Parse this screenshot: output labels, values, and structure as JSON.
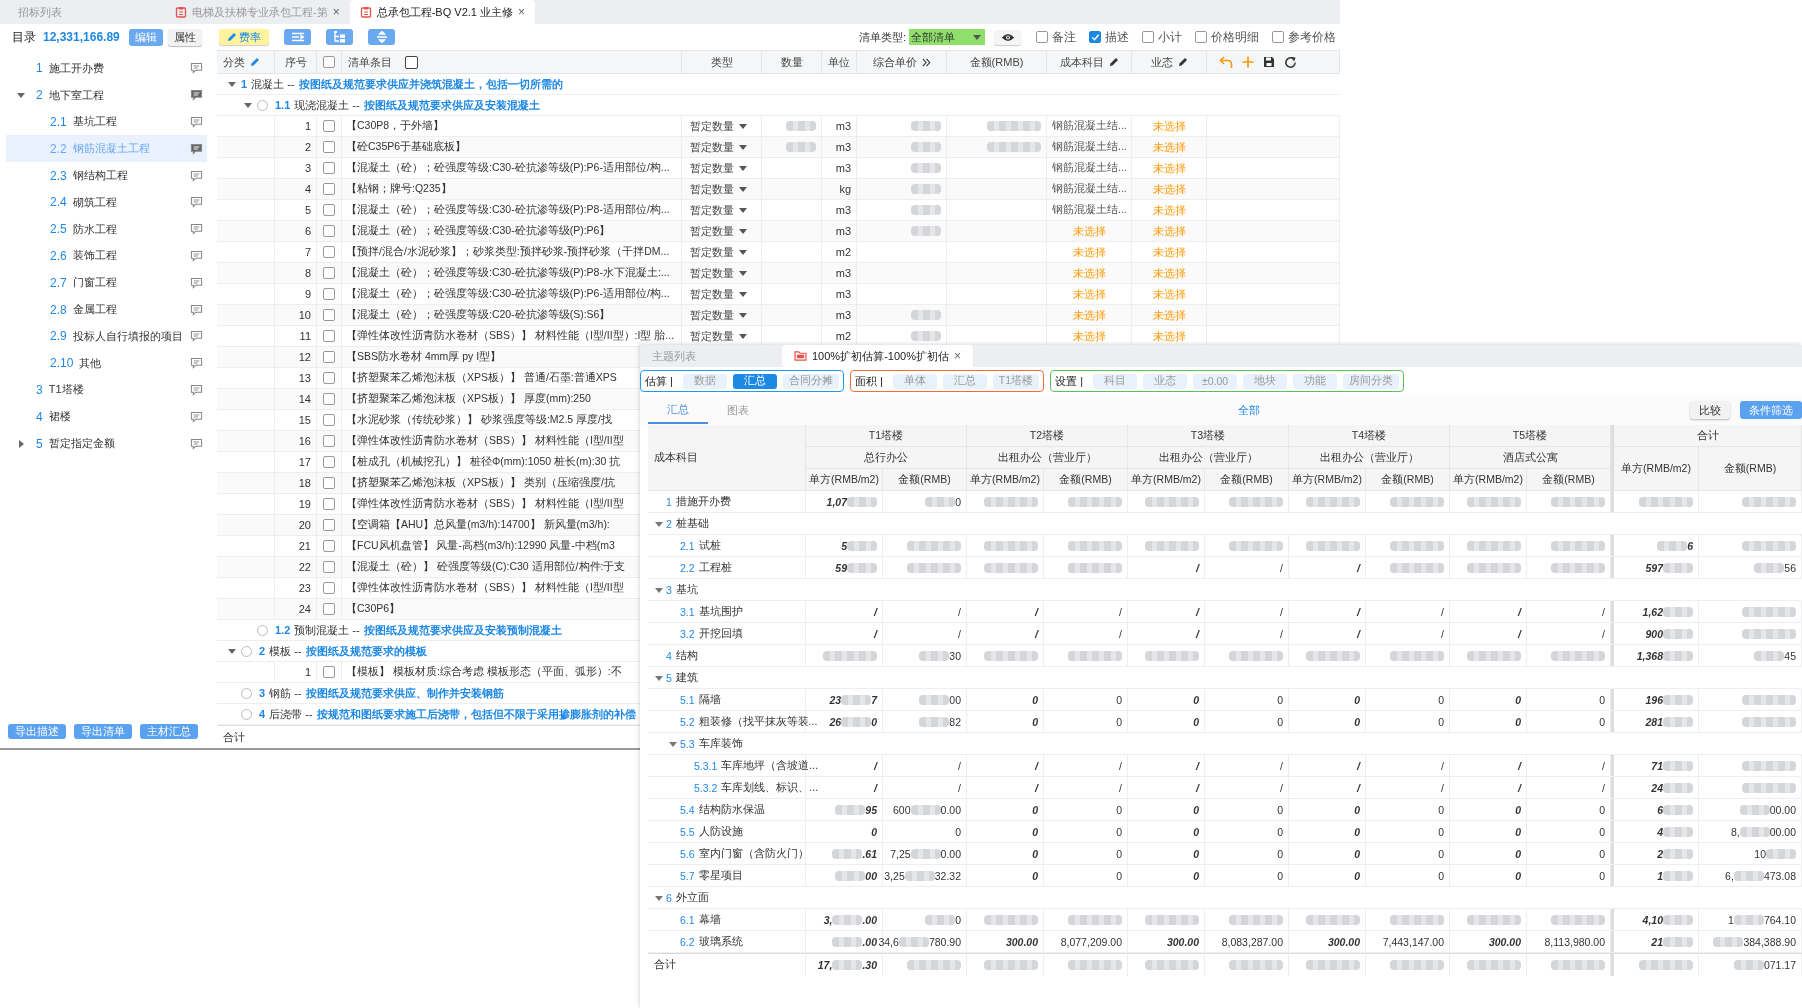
{
  "top_window": {
    "tabs": [
      {
        "label": "招标列表",
        "selected": false
      },
      {
        "label": "电梯及扶梯专业承包工程-第",
        "selected": false,
        "close": "×"
      },
      {
        "label": "总承包工程-BQ V2.1 业主修",
        "selected": true,
        "close": "×"
      }
    ],
    "sidebar": {
      "title": "目录",
      "total": "12,331,166.89",
      "buttons": [
        {
          "label": "编辑",
          "kind": "primary"
        },
        {
          "label": "属性",
          "kind": "plain"
        }
      ],
      "items": [
        {
          "number": "1",
          "label": "施工开办费",
          "selected": false,
          "commented": false
        },
        {
          "number": "2",
          "label": "地下室工程",
          "selected": false,
          "commented": true,
          "expanded": true,
          "children": [
            {
              "number": "2.1",
              "label": "基坑工程",
              "selected": false,
              "commented": false
            },
            {
              "number": "2.2",
              "label": "钢筋混凝土工程",
              "selected": true,
              "commented": true
            },
            {
              "number": "2.3",
              "label": "钢结构工程",
              "selected": false,
              "commented": false
            },
            {
              "number": "2.4",
              "label": "砌筑工程",
              "selected": false,
              "commented": false
            },
            {
              "number": "2.5",
              "label": "防水工程",
              "selected": false,
              "commented": false
            },
            {
              "number": "2.6",
              "label": "装饰工程",
              "selected": false,
              "commented": false
            },
            {
              "number": "2.7",
              "label": "门窗工程",
              "selected": false,
              "commented": false
            },
            {
              "number": "2.8",
              "label": "金属工程",
              "selected": false,
              "commented": false
            },
            {
              "number": "2.9",
              "label": "投标人自行填报的项目",
              "selected": false,
              "commented": false
            },
            {
              "number": "2.10",
              "label": "其他",
              "selected": false,
              "commented": false
            }
          ]
        },
        {
          "number": "3",
          "label": "T1塔楼",
          "selected": false,
          "commented": false
        },
        {
          "number": "4",
          "label": "裙楼",
          "selected": false,
          "commented": false
        },
        {
          "number": "5",
          "label": "暂定指定金额",
          "selected": false,
          "commented": false,
          "expanded": false
        }
      ],
      "footer_buttons": [
        "导出描述",
        "导出清单",
        "主材汇总"
      ]
    },
    "rate_button": "费率",
    "list_type": {
      "label": "清单类型:",
      "value": "全部清单"
    },
    "options": [
      {
        "label": "备注",
        "checked": false
      },
      {
        "label": "描述",
        "checked": true
      },
      {
        "label": "小计",
        "checked": false
      },
      {
        "label": "价格明细",
        "checked": false
      },
      {
        "label": "参考价格",
        "checked": false
      }
    ],
    "table": {
      "columns": [
        {
          "label": "分类",
          "editable": true
        },
        {
          "label": "序号"
        },
        {
          "label": "清单条目"
        },
        {
          "label": "类型"
        },
        {
          "label": "数量"
        },
        {
          "label": "单位"
        },
        {
          "label": "综合单价",
          "expandable": true
        },
        {
          "label": "金额(RMB)"
        },
        {
          "label": "成本科目",
          "editable": true
        },
        {
          "label": "业态",
          "editable": true
        }
      ],
      "select_all": {
        "checked": false
      },
      "entry_toggle": {
        "checked": false
      },
      "rows": [
        {
          "kind": "group",
          "number": "1",
          "name": "混凝土 --",
          "desc": "按图纸及规范要求供应并浇筑混凝土，包括一切所需的",
          "expanded": true,
          "children": [
            {
              "kind": "group",
              "number": "1.1",
              "name": "现浇混凝土 --",
              "desc": "按图纸及规范要求供应及安装混凝土",
              "selected": false,
              "expanded": true,
              "children": [
                {
                  "kind": "item",
                  "no": "1",
                  "checked": false,
                  "desc": "【C30P8，于外墙】",
                  "type": "暂定数量",
                  "qty_blurred": true,
                  "unit": "m3",
                  "price_blurred": true,
                  "amount_blurred": true,
                  "cost": {
                    "text": "钢筋混凝土结...",
                    "assigned": true
                  },
                  "status": {
                    "text": "未选择",
                    "assigned": false
                  }
                },
                {
                  "kind": "item",
                  "no": "2",
                  "checked": false,
                  "desc": "【砼C35P6于基础底板】",
                  "type": "暂定数量",
                  "qty_blurred": true,
                  "unit": "m3",
                  "price_blurred": true,
                  "amount_blurred": true,
                  "cost": {
                    "text": "钢筋混凝土结...",
                    "assigned": true
                  },
                  "status": {
                    "text": "未选择",
                    "assigned": false
                  }
                },
                {
                  "kind": "item",
                  "no": "3",
                  "checked": false,
                  "desc": "【混凝土（砼）；砼强度等级:C30-砼抗渗等级(P):P6-适用部位/构...",
                  "type": "暂定数量",
                  "qty_blurred": false,
                  "unit": "m3",
                  "price_blurred": true,
                  "amount_blurred": false,
                  "cost": {
                    "text": "钢筋混凝土结...",
                    "assigned": true
                  },
                  "status": {
                    "text": "未选择",
                    "assigned": false
                  }
                },
                {
                  "kind": "item",
                  "no": "4",
                  "checked": false,
                  "desc": "【粘钢；牌号:Q235】",
                  "type": "暂定数量",
                  "qty_blurred": false,
                  "unit": "kg",
                  "price_blurred": true,
                  "amount_blurred": false,
                  "cost": {
                    "text": "钢筋混凝土结...",
                    "assigned": true
                  },
                  "status": {
                    "text": "未选择",
                    "assigned": false
                  }
                },
                {
                  "kind": "item",
                  "no": "5",
                  "checked": false,
                  "desc": "【混凝土（砼）；砼强度等级:C30-砼抗渗等级(P):P8-适用部位/构...",
                  "type": "暂定数量",
                  "qty_blurred": false,
                  "unit": "m3",
                  "price_blurred": true,
                  "amount_blurred": false,
                  "cost": {
                    "text": "钢筋混凝土结...",
                    "assigned": true
                  },
                  "status": {
                    "text": "未选择",
                    "assigned": false
                  }
                },
                {
                  "kind": "item",
                  "no": "6",
                  "checked": false,
                  "desc": "【混凝土（砼）；砼强度等级:C30-砼抗渗等级(P):P6】",
                  "type": "暂定数量",
                  "qty_blurred": false,
                  "unit": "m3",
                  "price_blurred": true,
                  "amount_blurred": false,
                  "cost": {
                    "text": "未选择",
                    "assigned": false
                  },
                  "status": {
                    "text": "未选择",
                    "assigned": false
                  }
                },
                {
                  "kind": "item",
                  "no": "7",
                  "checked": false,
                  "desc": "【预拌/混合/水泥砂浆】；砂浆类型:预拌砂浆-预拌砂浆（干拌DM...",
                  "type": "暂定数量",
                  "qty_blurred": false,
                  "unit": "m2",
                  "price_blurred": false,
                  "amount_blurred": false,
                  "cost": {
                    "text": "未选择",
                    "assigned": false
                  },
                  "status": {
                    "text": "未选择",
                    "assigned": false
                  }
                },
                {
                  "kind": "item",
                  "no": "8",
                  "checked": false,
                  "desc": "【混凝土（砼）；砼强度等级:C30-砼抗渗等级(P):P8-水下混凝土:...",
                  "type": "暂定数量",
                  "qty_blurred": false,
                  "unit": "m3",
                  "price_blurred": false,
                  "amount_blurred": false,
                  "cost": {
                    "text": "未选择",
                    "assigned": false
                  },
                  "status": {
                    "text": "未选择",
                    "assigned": false
                  }
                },
                {
                  "kind": "item",
                  "no": "9",
                  "checked": false,
                  "desc": "【混凝土（砼）；砼强度等级:C30-砼抗渗等级(P):P6-适用部位/构...",
                  "type": "暂定数量",
                  "qty_blurred": false,
                  "unit": "m3",
                  "price_blurred": false,
                  "amount_blurred": false,
                  "cost": {
                    "text": "未选择",
                    "assigned": false
                  },
                  "status": {
                    "text": "未选择",
                    "assigned": false
                  }
                },
                {
                  "kind": "item",
                  "no": "10",
                  "checked": false,
                  "desc": "【混凝土（砼）；砼强度等级:C20-砼抗渗等级(S):S6】",
                  "type": "暂定数量",
                  "qty_blurred": false,
                  "unit": "m3",
                  "price_blurred": true,
                  "amount_blurred": false,
                  "cost": {
                    "text": "未选择",
                    "assigned": false
                  },
                  "status": {
                    "text": "未选择",
                    "assigned": false
                  }
                },
                {
                  "kind": "item",
                  "no": "11",
                  "checked": false,
                  "desc": "【弹性体改性沥青防水卷材（SBS）】 材料性能（I型/II型）:I型 胎...",
                  "type": "暂定数量",
                  "qty_blurred": false,
                  "unit": "m2",
                  "price_blurred": true,
                  "amount_blurred": false,
                  "cost": {
                    "text": "未选择",
                    "assigned": false
                  },
                  "status": {
                    "text": "未选择",
                    "assigned": false
                  }
                },
                {
                  "kind": "item",
                  "no": "12",
                  "checked": false,
                  "desc": "【SBS防水卷材 4mm厚 py I型】"
                },
                {
                  "kind": "item",
                  "no": "13",
                  "checked": false,
                  "desc": "【挤塑聚苯乙烯泡沫板（XPS板）】 普通/石墨:普通XPS"
                },
                {
                  "kind": "item",
                  "no": "14",
                  "checked": false,
                  "desc": "【挤塑聚苯乙烯泡沫板（XPS板）】 厚度(mm):250"
                },
                {
                  "kind": "item",
                  "no": "15",
                  "checked": false,
                  "desc": "【水泥砂浆（传统砂浆）】 砂浆强度等级:M2.5 厚度/找"
                },
                {
                  "kind": "item",
                  "no": "16",
                  "checked": false,
                  "desc": "【弹性体改性沥青防水卷材（SBS）】 材料性能（I型/II型"
                },
                {
                  "kind": "item",
                  "no": "17",
                  "checked": false,
                  "desc": "【桩成孔（机械挖孔）】 桩径Φ(mm):1050 桩长(m):30 抗"
                },
                {
                  "kind": "item",
                  "no": "18",
                  "checked": false,
                  "desc": "【挤塑聚苯乙烯泡沫板（XPS板）】 类别（压缩强度/抗"
                },
                {
                  "kind": "item",
                  "no": "19",
                  "checked": false,
                  "desc": "【弹性体改性沥青防水卷材（SBS）】 材料性能（I型/II型"
                },
                {
                  "kind": "item",
                  "no": "20",
                  "checked": false,
                  "desc": "【空调箱【AHU】总风量(m3/h):14700】 新风量(m3/h):"
                },
                {
                  "kind": "item",
                  "no": "21",
                  "checked": false,
                  "desc": "【FCU风机盘管】 风量-高档(m3/h):12990 风量-中档(m3"
                },
                {
                  "kind": "item",
                  "no": "22",
                  "checked": false,
                  "desc": "【混凝土（砼）】 砼强度等级(C):C30 适用部位/构件:于支"
                },
                {
                  "kind": "item",
                  "no": "23",
                  "checked": false,
                  "desc": "【弹性体改性沥青防水卷材（SBS）】 材料性能（I型/II型"
                },
                {
                  "kind": "item",
                  "no": "24",
                  "checked": false,
                  "desc": "【C30P6】"
                }
              ]
            },
            {
              "kind": "group",
              "number": "1.2",
              "name": "预制混凝土 --",
              "desc": "按图纸及规范要求供应及安装预制混凝土",
              "selected": false
            }
          ]
        },
        {
          "kind": "group",
          "number": "2",
          "name": "模板 --",
          "desc": "按图纸及规范要求的模板",
          "selected": false,
          "expanded": true,
          "children": [
            {
              "kind": "item",
              "no": "1",
              "checked": false,
              "desc": "【模板】 模板材质:综合考虑 模板形态（平面、弧形）:不"
            }
          ]
        },
        {
          "kind": "group",
          "number": "3",
          "name": "钢筋 --",
          "desc": "按图纸及规范要求供应、制作并安装钢筋",
          "selected": false
        },
        {
          "kind": "group",
          "number": "4",
          "name": "后浇带 --",
          "desc": "按规范和图纸要求施工后浇带，包括但不限于采用掺膨胀剂的补偿",
          "selected": false
        }
      ],
      "footer": "合计"
    }
  },
  "bottom_panel": {
    "tabs": [
      {
        "label": "主题列表",
        "selected": false
      },
      {
        "label": "100%扩初估算-100%扩初估",
        "selected": true,
        "close": "×"
      }
    ],
    "filter_groups": [
      {
        "label": "估算 |",
        "color": "#1e9bf0",
        "options": [
          {
            "label": "数据",
            "selected": false
          },
          {
            "label": "汇总",
            "selected": true
          },
          {
            "label": "合同分摊",
            "selected": false
          }
        ]
      },
      {
        "label": "面积 |",
        "color": "#f26b3a",
        "options": [
          {
            "label": "单体",
            "selected": false
          },
          {
            "label": "汇总",
            "selected": false
          },
          {
            "label": "T1塔楼",
            "selected": false
          }
        ]
      },
      {
        "label": "设置 |",
        "color": "#5cbf5c",
        "options": [
          {
            "label": "科目",
            "selected": false
          },
          {
            "label": "业态",
            "selected": false
          },
          {
            "label": "±0.00",
            "selected": false
          },
          {
            "label": "地块",
            "selected": false
          },
          {
            "label": "功能",
            "selected": false
          },
          {
            "label": "房间分类",
            "selected": false
          }
        ]
      }
    ],
    "view_tabs": [
      {
        "label": "汇总",
        "selected": true
      },
      {
        "label": "图表",
        "selected": false
      }
    ],
    "scope": "全部",
    "buttons": [
      {
        "label": "比较",
        "kind": "plain"
      },
      {
        "label": "条件筛选",
        "kind": "primary"
      }
    ],
    "table": {
      "first_column": "成本科目",
      "groups": [
        {
          "name": "T1塔楼",
          "use": "总行办公",
          "columns": [
            "单方(RMB/m2)",
            "金额(RMB)"
          ]
        },
        {
          "name": "T2塔楼",
          "use": "出租办公（营业厅）",
          "columns": [
            "单方(RMB/m2)",
            "金额(RMB)"
          ]
        },
        {
          "name": "T3塔楼",
          "use": "出租办公（营业厅）",
          "columns": [
            "单方(RMB/m2)",
            "金额(RMB)"
          ]
        },
        {
          "name": "T4塔楼",
          "use": "出租办公（营业厅）",
          "columns": [
            "单方(RMB/m2)",
            "金额(RMB)"
          ]
        },
        {
          "name": "T5塔楼",
          "use": "酒店式公寓",
          "columns": [
            "单方(RMB/m2)",
            "金额(RMB)"
          ]
        }
      ],
      "total": {
        "name": "合计",
        "columns": [
          "单方(RMB/m2)",
          "金额(RMB)"
        ]
      },
      "rows": [
        {
          "number": "1",
          "name": "措施开办费",
          "cells": [
            {
              "head": "1,07",
              "blurred": true
            },
            {
              "tail": "0",
              "blurred": true
            },
            {
              "blurred": true
            },
            {
              "blurred": true
            },
            {
              "blurred": true
            },
            {
              "blurred": true
            },
            {
              "blurred": true
            },
            {
              "blurred": true
            },
            {
              "blurred": true
            },
            {
              "blurred": true
            },
            {
              "blurred": true
            },
            {
              "blurred": true
            }
          ]
        },
        {
          "number": "2",
          "name": "桩基础",
          "expanded": true,
          "children": [
            {
              "number": "2.1",
              "name": "试桩",
              "cells": [
                {
                  "head": "5",
                  "blurred": true
                },
                {
                  "blurred": true
                },
                {
                  "blurred": true
                },
                {
                  "blurred": true
                },
                {
                  "blurred": true
                },
                {
                  "blurred": true
                },
                {
                  "blurred": true
                },
                {
                  "blurred": true
                },
                {
                  "blurred": true
                },
                {
                  "blurred": true
                },
                {
                  "tail": "6",
                  "blurred": true
                },
                {
                  "blurred": true
                }
              ]
            },
            {
              "number": "2.2",
              "name": "工程桩",
              "cells": [
                {
                  "head": "59",
                  "blurred": true
                },
                {
                  "blurred": true
                },
                {
                  "blurred": true
                },
                {
                  "blurred": true
                },
                "/",
                "/",
                "/",
                {
                  "blurred": true
                },
                {
                  "blurred": true
                },
                {
                  "blurred": true
                },
                {
                  "head": "597",
                  "blurred": true
                },
                {
                  "tail": "56",
                  "blurred": true
                }
              ]
            }
          ]
        },
        {
          "number": "3",
          "name": "基坑",
          "expanded": true,
          "children": [
            {
              "number": "3.1",
              "name": "基坑围护",
              "cells": [
                "/",
                "/",
                "/",
                "/",
                "/",
                "/",
                "/",
                "/",
                "/",
                "/",
                {
                  "head": "1,62",
                  "blurred": true
                },
                {
                  "blurred": true
                }
              ]
            },
            {
              "number": "3.2",
              "name": "开挖回填",
              "cells": [
                "/",
                "/",
                "/",
                "/",
                "/",
                "/",
                "/",
                "/",
                "/",
                "/",
                {
                  "head": "900",
                  "blurred": true
                },
                {
                  "blurred": true
                }
              ]
            }
          ]
        },
        {
          "number": "4",
          "name": "结构",
          "cells": [
            {
              "blurred": true
            },
            {
              "tail": "30",
              "blurred": true
            },
            {
              "blurred": true
            },
            {
              "blurred": true
            },
            {
              "blurred": true
            },
            {
              "blurred": true
            },
            {
              "blurred": true
            },
            {
              "blurred": true
            },
            {
              "blurred": true
            },
            {
              "blurred": true
            },
            {
              "head": "1,368",
              "blurred": true
            },
            {
              "tail": "45",
              "blurred": true
            }
          ]
        },
        {
          "number": "5",
          "name": "建筑",
          "expanded": true,
          "children": [
            {
              "number": "5.1",
              "name": "隔墙",
              "cells": [
                {
                  "head": "23",
                  "tail": "7",
                  "blurred": true
                },
                {
                  "tail": "00",
                  "blurred": true
                },
                "0",
                "0",
                "0",
                "0",
                "0",
                "0",
                "0",
                "0",
                {
                  "head": "196",
                  "blurred": true
                },
                {
                  "blurred": true
                }
              ]
            },
            {
              "number": "5.2",
              "name": "粗装修（找平抹灰等装...",
              "cells": [
                {
                  "head": "26",
                  "tail": "0",
                  "blurred": true
                },
                {
                  "tail": "82",
                  "blurred": true
                },
                "0",
                "0",
                "0",
                "0",
                "0",
                "0",
                "0",
                "0",
                {
                  "head": "281",
                  "blurred": true
                },
                {
                  "blurred": true
                }
              ]
            },
            {
              "number": "5.3",
              "name": "车库装饰",
              "expanded": true,
              "children": [
                {
                  "number": "5.3.1",
                  "name": "车库地坪（含坡道...",
                  "cells": [
                    "/",
                    "/",
                    "/",
                    "/",
                    "/",
                    "/",
                    "/",
                    "/",
                    "/",
                    "/",
                    {
                      "head": "71",
                      "blurred": true
                    },
                    {
                      "blurred": true
                    }
                  ]
                },
                {
                  "number": "5.3.2",
                  "name": "车库划线、标识、...",
                  "cells": [
                    "/",
                    "/",
                    "/",
                    "/",
                    "/",
                    "/",
                    "/",
                    "/",
                    "/",
                    "/",
                    {
                      "head": "24",
                      "blurred": true
                    },
                    {
                      "blurred": true
                    }
                  ]
                }
              ]
            },
            {
              "number": "5.4",
              "name": "结构防水保温",
              "cells": [
                {
                  "tail": "95",
                  "blurred": true
                },
                {
                  "head": "600",
                  "tail": "0.00",
                  "blurred": true
                },
                "0",
                "0",
                "0",
                "0",
                "0",
                "0",
                "0",
                "0",
                {
                  "head": "6",
                  "blurred": true
                },
                {
                  "tail": "00.00",
                  "blurred": true
                }
              ]
            },
            {
              "number": "5.5",
              "name": "人防设施",
              "cells": [
                "0",
                "0",
                "0",
                "0",
                "0",
                "0",
                "0",
                "0",
                "0",
                "0",
                {
                  "head": "4",
                  "blurred": true
                },
                {
                  "head": "8,",
                  "tail": "00.00",
                  "blurred": true
                }
              ]
            },
            {
              "number": "5.6",
              "name": "室内门窗（含防火门）",
              "cells": [
                {
                  "tail": ".61",
                  "blurred": true
                },
                {
                  "head": "7,25",
                  "tail": "0.00",
                  "blurred": true
                },
                "0",
                "0",
                "0",
                "0",
                "0",
                "0",
                "0",
                "0",
                {
                  "head": "2",
                  "blurred": true
                },
                {
                  "head": "10",
                  "blurred": true
                }
              ]
            },
            {
              "number": "5.7",
              "name": "零星项目",
              "cells": [
                {
                  "tail": "00",
                  "blurred": true
                },
                {
                  "head": "3,25",
                  "tail": "32.32",
                  "blurred": true
                },
                "0",
                "0",
                "0",
                "0",
                "0",
                "0",
                "0",
                "0",
                {
                  "head": "1",
                  "blurred": true
                },
                {
                  "head": "6,",
                  "tail": "473.08",
                  "blurred": true
                }
              ]
            }
          ]
        },
        {
          "number": "6",
          "name": "外立面",
          "expanded": true,
          "children": [
            {
              "number": "6.1",
              "name": "幕墙",
              "cells": [
                {
                  "head": "3,",
                  "tail": ".00",
                  "blurred": true
                },
                {
                  "tail": "0",
                  "blurred": true
                },
                {
                  "blurred": true
                },
                {
                  "blurred": true
                },
                {
                  "blurred": true
                },
                {
                  "blurred": true
                },
                {
                  "blurred": true
                },
                {
                  "blurred": true
                },
                {
                  "blurred": true
                },
                {
                  "blurred": true
                },
                {
                  "head": "4,10",
                  "blurred": true
                },
                {
                  "head": "1",
                  "tail": "764.10",
                  "blurred": true
                }
              ]
            },
            {
              "number": "6.2",
              "name": "玻璃系统",
              "cells": [
                {
                  "tail": ".00",
                  "blurred": true
                },
                {
                  "head": "34,6",
                  "tail": "780.90",
                  "blurred": true
                },
                "300.00",
                "8,077,209.00",
                "300.00",
                "8,083,287.00",
                "300.00",
                "7,443,147.00",
                "300.00",
                "8,113,980.00",
                {
                  "head": "21",
                  "blurred": true
                },
                {
                  "tail": "384,388.90",
                  "blurred": true
                }
              ]
            }
          ]
        }
      ],
      "footer": {
        "label": "合计",
        "cells": [
          {
            "head": "17,",
            "tail": ".30",
            "blurred": true
          },
          {
            "blurred": true
          },
          {
            "blurred": true
          },
          {
            "blurred": true
          },
          {
            "blurred": true
          },
          {
            "blurred": true
          },
          {
            "blurred": true
          },
          {
            "blurred": true
          },
          {
            "blurred": true
          },
          {
            "blurred": true
          },
          {
            "blurred": true
          },
          {
            "tail": "071.17",
            "blurred": true
          }
        ]
      }
    }
  }
}
